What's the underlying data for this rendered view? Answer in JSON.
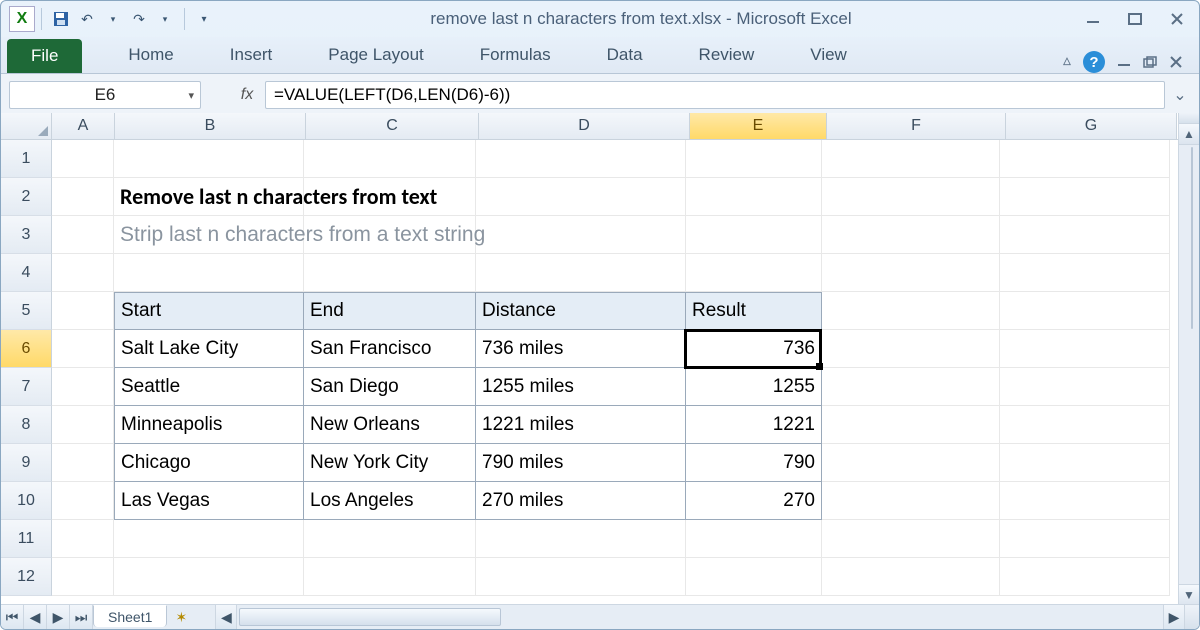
{
  "window": {
    "title": "remove last n characters from text.xlsx  -  Microsoft Excel",
    "app_letter": "X"
  },
  "ribbon": {
    "file": "File",
    "tabs": [
      "Home",
      "Insert",
      "Page Layout",
      "Formulas",
      "Data",
      "Review",
      "View"
    ]
  },
  "formula_bar": {
    "name_box": "E6",
    "fx": "fx",
    "formula": "=VALUE(LEFT(D6,LEN(D6)-6))"
  },
  "columns": {
    "labels": [
      "A",
      "B",
      "C",
      "D",
      "E",
      "F",
      "G"
    ],
    "widths": [
      62,
      190,
      172,
      210,
      136,
      178,
      170
    ],
    "selected": "E"
  },
  "rows": {
    "count_visible": 12,
    "selected": 6
  },
  "content": {
    "title": "Remove last n characters from text",
    "subtitle": "Strip last n characters from a text string",
    "headers": [
      "Start",
      "End",
      "Distance",
      "Result"
    ],
    "data": [
      {
        "start": "Salt Lake City",
        "end": "San Francisco",
        "distance": "736 miles",
        "result": "736"
      },
      {
        "start": "Seattle",
        "end": "San Diego",
        "distance": "1255 miles",
        "result": "1255"
      },
      {
        "start": "Minneapolis",
        "end": "New Orleans",
        "distance": "1221 miles",
        "result": "1221"
      },
      {
        "start": "Chicago",
        "end": "New York City",
        "distance": "790 miles",
        "result": "790"
      },
      {
        "start": "Las Vegas",
        "end": "Los Angeles",
        "distance": "270 miles",
        "result": "270"
      }
    ]
  },
  "sheet_tabs": {
    "active": "Sheet1"
  },
  "active_cell": {
    "col": "E",
    "row": 6
  }
}
